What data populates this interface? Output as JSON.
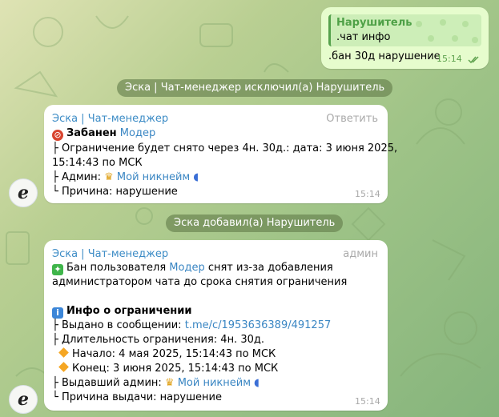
{
  "msg1": {
    "quote_author": "Нарушитель",
    "quote_text": ".чат инфо",
    "text": ".бан 30д нарушение",
    "time": "15:14"
  },
  "service1": "Эска | Чат-менеджер исключил(а) Нарушитель",
  "msg2": {
    "sender": "Эска | Чат-менеджер",
    "reply": "Ответить",
    "l1_prefix": "Забанен",
    "l1_link": "Модер",
    "l2": "├ Ограничение будет снято через 4н. 30д.: дата: 3 июня 2025,",
    "l3": "15:14:43 по МСК",
    "l4_prefix": "├ Админ:",
    "l4_link": "Мой никнейм",
    "l5": "└ Причина: нарушение",
    "time": "15:14"
  },
  "service2": "Эска добавил(а) Нарушитель",
  "msg3": {
    "sender": "Эска | Чат-менеджер",
    "badge": "админ",
    "l1_prefix": "Бан пользователя",
    "l1_link": "Модер",
    "l1_suffix": "снят из-за добавления",
    "l2": "администратором чата до срока снятия ограничения",
    "l4": "Инфо о ограничении",
    "l5_prefix": "├ Выдано в сообщении:",
    "l5_link": "t.me/c/1953636389/491257",
    "l6": "├ Длительность ограничения: 4н. 30д.",
    "l7": "Начало: 4 мая 2025, 15:14:43 по МСК",
    "l8": "Конец: 3 июня 2025, 15:14:43 по МСК",
    "l9_prefix": "├ Выдавший админ:",
    "l9_link": "Мой никнейм",
    "l10": "└ Причина выдачи: нарушение",
    "time": "15:14"
  },
  "avatar_letter": "e"
}
